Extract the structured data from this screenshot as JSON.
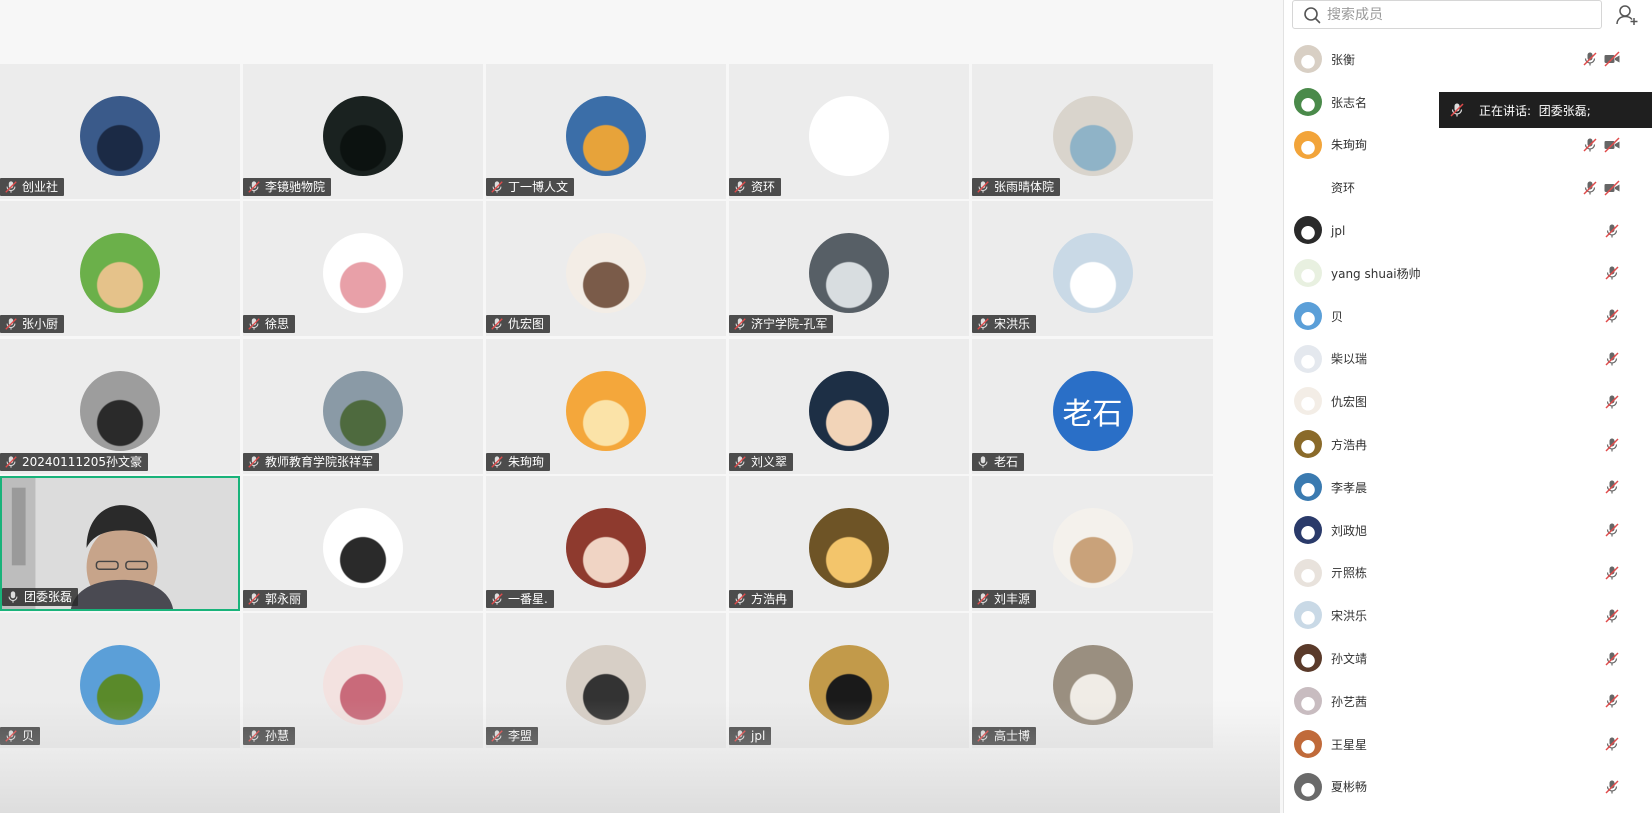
{
  "search": {
    "placeholder": "搜索成员"
  },
  "speaking": {
    "label": "正在讲话:",
    "name": "团委张磊;"
  },
  "tiles": [
    {
      "name": "创业社",
      "bg": "#3a5a8a",
      "fg": "#1b2a45"
    },
    {
      "name": "李镜驰物院",
      "bg": "#1a2220",
      "fg": "#0c1210"
    },
    {
      "name": "丁一博人文",
      "bg": "#3b6ea8",
      "fg": "#e7a33a"
    },
    {
      "name": "资环",
      "bg": "#ffffff",
      "fg": "#ffffff"
    },
    {
      "name": "张雨晴体院",
      "bg": "#d9d4cc",
      "fg": "#8fb3c7"
    },
    {
      "name": "张小厨",
      "bg": "#6bb04a",
      "fg": "#e5c28a"
    },
    {
      "name": "徐思",
      "bg": "#ffffff",
      "fg": "#e8a0a8"
    },
    {
      "name": "仇宏图",
      "bg": "#f3ede6",
      "fg": "#7a5b49"
    },
    {
      "name": "济宁学院-孔军",
      "bg": "#575f66",
      "fg": "#d8dde0"
    },
    {
      "name": "宋洪乐",
      "bg": "#c9d9e6",
      "fg": "#ffffff"
    },
    {
      "name": "20240111205孙文豪",
      "bg": "#9d9d9d",
      "fg": "#2a2a2a"
    },
    {
      "name": "教师教育学院张祥军",
      "bg": "#8a9aa6",
      "fg": "#4e6a3e"
    },
    {
      "name": "朱珣珣",
      "bg": "#f4a73b",
      "fg": "#fbe3a8"
    },
    {
      "name": "刘义翠",
      "bg": "#1d2f45",
      "fg": "#f2d4b8"
    },
    {
      "name": "老石",
      "bg": "#2a6fc7",
      "fg": "#2a6fc7",
      "initials": "老石"
    },
    {
      "name": "团委张磊",
      "video": true
    },
    {
      "name": "郭永丽",
      "bg": "#ffffff",
      "fg": "#2a2a2a"
    },
    {
      "name": "一番星.",
      "bg": "#8e3a2e",
      "fg": "#f0d4c4"
    },
    {
      "name": "方浩冉",
      "bg": "#6e5426",
      "fg": "#f3c56b"
    },
    {
      "name": "刘丰源",
      "bg": "#f4f1ec",
      "fg": "#c9a27a"
    },
    {
      "name": "贝",
      "bg": "#5b9fd8",
      "fg": "#5a8a2a"
    },
    {
      "name": "孙慧",
      "bg": "#f3e2e0",
      "fg": "#c96a7a"
    },
    {
      "name": "李盟",
      "bg": "#d7cfc6",
      "fg": "#333333"
    },
    {
      "name": "jpl",
      "bg": "#c29a4a",
      "fg": "#1a1a1a"
    },
    {
      "name": "高士博",
      "bg": "#9a8f80",
      "fg": "#f0ece6"
    }
  ],
  "members": [
    {
      "name": "张衡",
      "color": "#d8cfc4",
      "cam": true
    },
    {
      "name": "张志名",
      "color": "#4a8a4a",
      "cam": false,
      "hideMic": true
    },
    {
      "name": "朱珣珣",
      "color": "#f2a43a",
      "cam": true
    },
    {
      "name": "资环",
      "color": "#ffffff",
      "cam": true
    },
    {
      "name": "jpl",
      "color": "#2a2a2a",
      "cam": false
    },
    {
      "name": "yang shuai杨帅",
      "color": "#e8f0e0",
      "cam": false
    },
    {
      "name": "贝",
      "color": "#5b9fd8",
      "cam": false
    },
    {
      "name": "柴以瑞",
      "color": "#e4e8ee",
      "cam": false
    },
    {
      "name": "仇宏图",
      "color": "#f3ede6",
      "cam": false
    },
    {
      "name": "方浩冉",
      "color": "#8a6a2a",
      "cam": false
    },
    {
      "name": "李孝晨",
      "color": "#3a7ab0",
      "cam": false
    },
    {
      "name": "刘政旭",
      "color": "#2a3a6a",
      "cam": false
    },
    {
      "name": "亓照栋",
      "color": "#e8e2dc",
      "cam": false
    },
    {
      "name": "宋洪乐",
      "color": "#c9d9e6",
      "cam": false
    },
    {
      "name": "孙文靖",
      "color": "#5a3a2a",
      "cam": false
    },
    {
      "name": "孙艺茜",
      "color": "#c8bcc0",
      "cam": false
    },
    {
      "name": "王星星",
      "color": "#c06a3a",
      "cam": false
    },
    {
      "name": "夏彬畅",
      "color": "#6a6a6a",
      "cam": false
    }
  ]
}
